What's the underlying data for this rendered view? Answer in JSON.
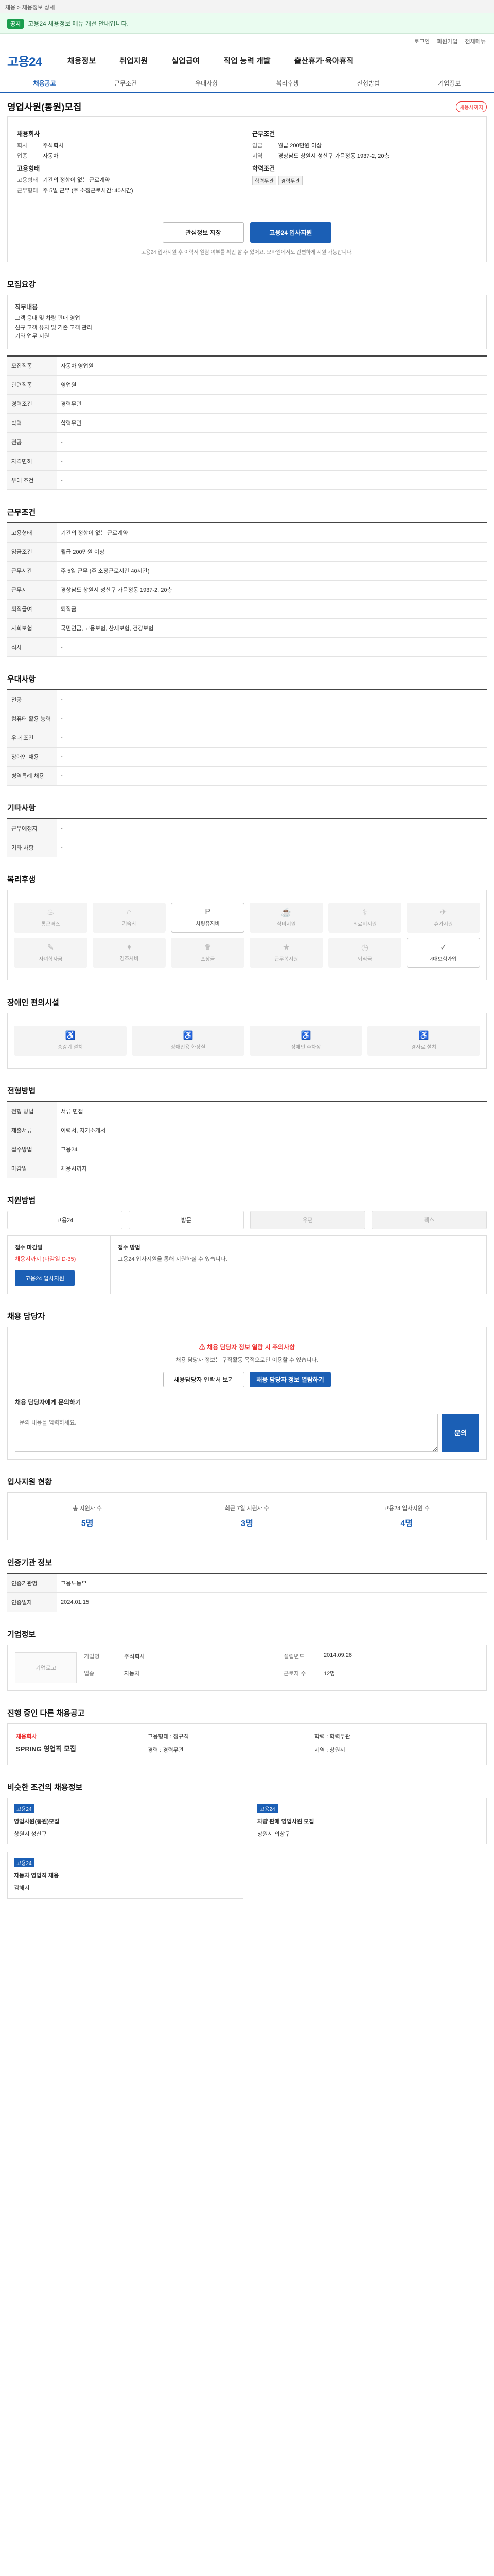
{
  "topbar": {
    "text": "채용 > 채용정보 상세"
  },
  "notice": {
    "badge": "공지",
    "text": "고용24 채용정보 메뉴 개선 안내입니다."
  },
  "util": [
    "로그인",
    "회원가입",
    "전체메뉴"
  ],
  "header": {
    "logo": "고용24",
    "gnb": [
      "채용정보",
      "취업지원",
      "실업급여",
      "직업 능력 개발",
      "출산휴가·육아휴직"
    ]
  },
  "subtabs": [
    "채용공고",
    "근무조건",
    "우대사항",
    "복리후생",
    "전형방법",
    "기업정보"
  ],
  "job": {
    "title": "영업사원(통원)모집",
    "badge": "채용시까지",
    "left": {
      "h1": "채용회사",
      "rows": [
        [
          "회사",
          "주식회사"
        ],
        [
          "업종",
          "자동차"
        ]
      ],
      "h2": "고용형태",
      "rows2": [
        [
          "고용형태",
          "기간의 정함이 없는 근로계약"
        ],
        [
          "근무형태",
          "주 5일 근무 (주 소정근로시간: 40시간)"
        ]
      ]
    },
    "right": {
      "h1": "근무조건",
      "rows": [
        [
          "임금",
          "월급 200만원 이상"
        ],
        [
          "지역",
          "경상남도 창원시 성산구 가음정동 1937-2, 20층"
        ]
      ],
      "h2": "학력조건",
      "tags": [
        "학력무관",
        "경력무관"
      ]
    }
  },
  "actions": {
    "interest": "관심정보 저장",
    "apply": "고용24 입사지원",
    "note": "고용24 입사지원 후 이력서 열람 여부를 확인 할 수 있어요. 모바일에서도 간편하게 지원 가능합니다."
  },
  "s1": {
    "title": "모집요강",
    "h": "직무내용",
    "lines": [
      "고객 응대 및 차량 판매 영업",
      "신규 고객 유치 및 기존 고객 관리",
      "기타 업무 지원"
    ],
    "rows": [
      [
        "모집직종",
        "자동차 영업원"
      ],
      [
        "관련직종",
        "영업원"
      ],
      [
        "경력조건",
        "경력무관"
      ],
      [
        "학력",
        "학력무관"
      ],
      [
        "전공",
        "-"
      ],
      [
        "자격면허",
        "-"
      ],
      [
        "우대 조건",
        "-"
      ]
    ]
  },
  "s2": {
    "title": "근무조건",
    "rows": [
      [
        "고용형태",
        "기간의 정함이 없는 근로계약"
      ],
      [
        "임금조건",
        "월급 200만원 이상"
      ],
      [
        "근무시간",
        "주 5일 근무 (주 소정근로시간 40시간)"
      ],
      [
        "근무지",
        "경상남도 창원시 성산구 가음정동 1937-2, 20층"
      ],
      [
        "퇴직급여",
        "퇴직금"
      ],
      [
        "사회보험",
        "국민연금, 고용보험, 산재보험, 건강보험"
      ],
      [
        "식사",
        "-"
      ]
    ]
  },
  "s3": {
    "title": "우대사항",
    "rows": [
      [
        "전공",
        "-"
      ],
      [
        "컴퓨터 활용 능력",
        "-"
      ],
      [
        "우대 조건",
        "-"
      ],
      [
        "장애인 채용",
        "-"
      ],
      [
        "병역특례 채용",
        "-"
      ]
    ]
  },
  "s4": {
    "title": "기타사항",
    "rows": [
      [
        "근무예정지",
        "-"
      ],
      [
        "기타 사항",
        "-"
      ]
    ]
  },
  "s5": {
    "title": "복리후생",
    "items": [
      [
        "♨",
        "통근버스"
      ],
      [
        "⌂",
        "기숙사"
      ],
      [
        "P",
        "차량유지비"
      ],
      [
        "☕",
        "식비지원"
      ],
      [
        "⚕",
        "의료비지원"
      ],
      [
        "✈",
        "휴가지원"
      ],
      [
        "✎",
        "자녀학자금"
      ],
      [
        "♦",
        "경조사비"
      ],
      [
        "♛",
        "포상금"
      ],
      [
        "★",
        "근무복지원"
      ],
      [
        "◷",
        "퇴직금"
      ],
      [
        "✓",
        "4대보험가입"
      ]
    ],
    "on": [
      2,
      11
    ]
  },
  "s6": {
    "title": "장애인 편의시설",
    "items": [
      [
        "♿",
        "승강기 설치"
      ],
      [
        "♿",
        "장애인용 화장실"
      ],
      [
        "♿",
        "장애인 주차장"
      ],
      [
        "♿",
        "경사로 설치"
      ]
    ]
  },
  "s7": {
    "title": "전형방법",
    "rows": [
      [
        "전형 방법",
        "서류 면접"
      ],
      [
        "제출서류",
        "이력서, 자기소개서"
      ],
      [
        "접수방법",
        "고용24"
      ],
      [
        "마감일",
        "채용시까지"
      ]
    ]
  },
  "s8": {
    "title": "지원방법",
    "methods": [
      "고용24",
      "방문",
      "우편",
      "팩스"
    ],
    "leftH": "접수 마감일",
    "leftV": "채용시까지 (마감일 D-35)",
    "rightH": "접수 방법",
    "rightV": "고용24 입사지원을 통해 지원하실 수 있습니다.",
    "btn": "고용24 입사지원"
  },
  "s9": {
    "title": "채용 담당자",
    "warn": "채용 담당자 정보 열람 시 주의사항",
    "desc": "채용 담당자 정보는 구직활동 목적으로만 이용할 수 있습니다.",
    "btn1": "채용담당자 연락처 보기",
    "btn2": "채용 담당자 정보 열람하기",
    "inqTitle": "채용 담당자에게 문의하기",
    "inqPlaceholder": "문의 내용을 입력하세요.",
    "inqBtn": "문의"
  },
  "s10": {
    "title": "입사지원 현황",
    "items": [
      [
        "총 지원자 수",
        "5명"
      ],
      [
        "최근 7일 지원자 수",
        "3명"
      ],
      [
        "고용24 입사지원 수",
        "4명"
      ]
    ]
  },
  "s11": {
    "title": "인증기관 정보",
    "rows": [
      [
        "인증기관명",
        "고용노동부"
      ],
      [
        "인증일자",
        "2024.01.15"
      ]
    ]
  },
  "s12": {
    "title": "기업정보",
    "logo": "기업로고",
    "rows": [
      [
        "기업명",
        "주식회사"
      ],
      [
        "업종",
        "자동차"
      ],
      [
        "설립년도",
        "2014.09.26"
      ],
      [
        "근로자 수",
        "12명"
      ]
    ]
  },
  "s13": {
    "title": "진행 중인 다른 채용공고",
    "co": "채용회사",
    "jn": "SPRING 영업직 모집",
    "meta": [
      [
        "고용형태",
        "정규직"
      ],
      [
        "학력",
        "학력무관"
      ],
      [
        "경력",
        "경력무관"
      ],
      [
        "지역",
        "창원시"
      ]
    ]
  },
  "s14": {
    "title": "비슷한 조건의 채용정보",
    "cards": [
      [
        "고용24",
        "영업사원(통원)모집",
        "창원시 성산구"
      ],
      [
        "고용24",
        "차량 판매 영업사원 모집",
        "창원시 의창구"
      ],
      [
        "고용24",
        "자동차 영업직 채용",
        "김해시"
      ]
    ]
  }
}
